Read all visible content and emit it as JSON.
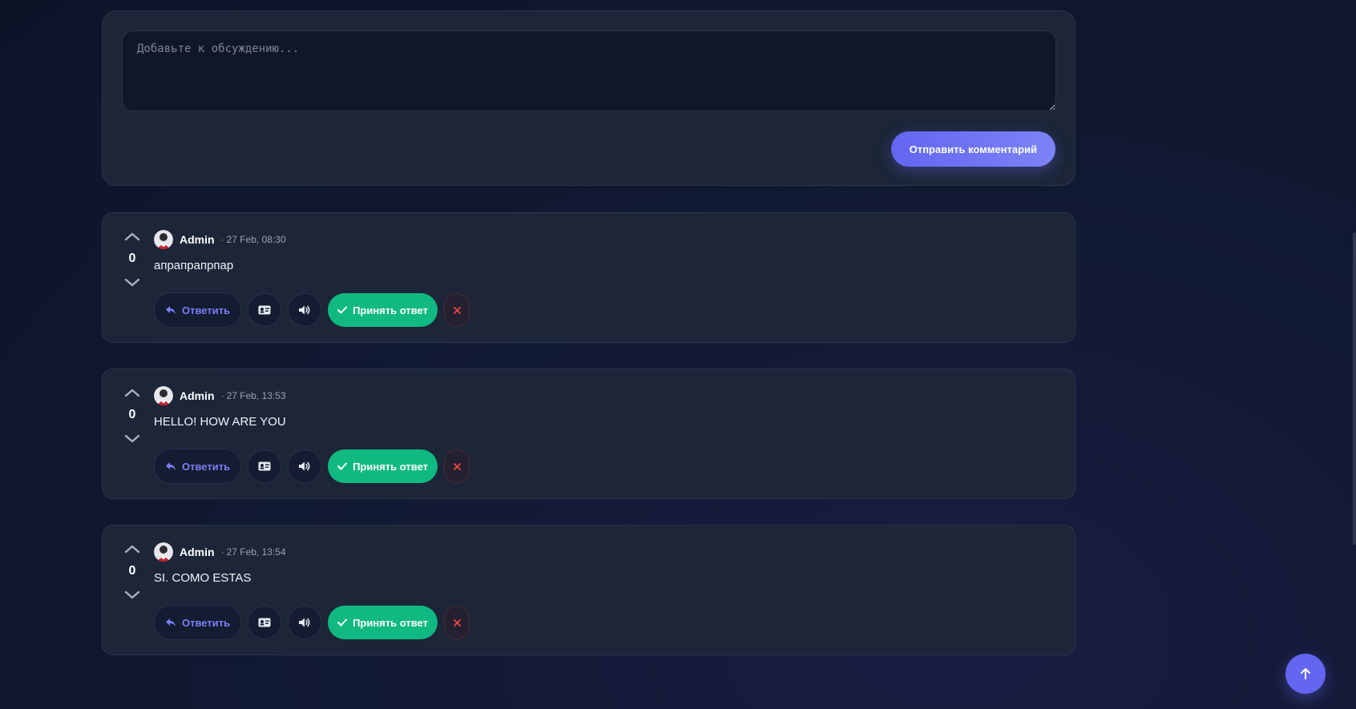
{
  "composer": {
    "placeholder": "Добавьте к обсуждению...",
    "submit_label": "Отправить комментарий"
  },
  "comments": [
    {
      "author": "Admin",
      "time": "27 Feb, 08:30",
      "score": "0",
      "text": "апрапрапрпар",
      "reply_label": "Ответить",
      "accept_label": "Принять ответ"
    },
    {
      "author": "Admin",
      "time": "27 Feb, 13:53",
      "score": "0",
      "text": "HELLO! HOW ARE YOU",
      "reply_label": "Ответить",
      "accept_label": "Принять ответ"
    },
    {
      "author": "Admin",
      "time": "27 Feb, 13:54",
      "score": "0",
      "text": "SI. COMO ESTAS",
      "reply_label": "Ответить",
      "accept_label": "Принять ответ"
    }
  ],
  "separator": "·",
  "icons": {
    "upvote": "chevron-up-icon",
    "downvote": "chevron-down-icon",
    "reply": "reply-icon",
    "card": "id-card-icon",
    "audio": "speaker-icon",
    "accept": "check-icon",
    "delete": "close-icon",
    "scroll_top": "arrow-up-icon"
  },
  "colors": {
    "accent": "#6366f1",
    "accept": "#10b981",
    "delete": "#ef4444",
    "card_bg": "#1c2638"
  }
}
